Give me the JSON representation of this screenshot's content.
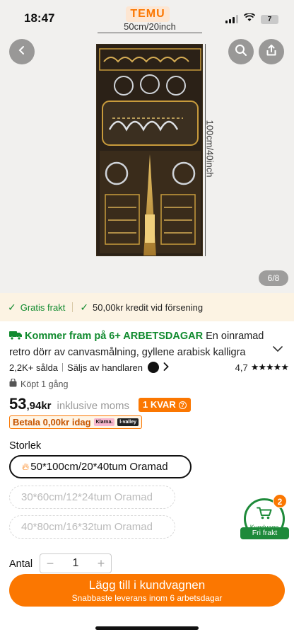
{
  "status_bar": {
    "time": "18:47",
    "battery": "7"
  },
  "brand": {
    "logo": "TEMU"
  },
  "product_image": {
    "width_label": "50cm/20inch",
    "height_label": "100cm/40inch",
    "counter": "6/8"
  },
  "benefits": {
    "free_shipping": "Gratis frakt",
    "late_credit": "50,00kr kredit vid försening"
  },
  "title": {
    "delivery": "Kommer fram på 6+ ARBETSDAGAR",
    "text": " En oinramad retro dörr av canvasmålning, gyllene arabisk kalligra"
  },
  "meta": {
    "sold": "2,2K+ sålda",
    "seller": "Säljs av handlaren",
    "rating": "4,7",
    "stars": "★★★★★",
    "bought": "Köpt 1 gång"
  },
  "price": {
    "main": "53",
    "decimal": ",94kr",
    "note": "inklusive moms",
    "stock": "1 KVAR",
    "pay_later": "Betala 0,00kr idag",
    "klarna": "Klarna.",
    "valley": "l-valley"
  },
  "size": {
    "label": "Storlek",
    "options": [
      {
        "label": "50*100cm/20*40tum Oramad",
        "selected": true
      },
      {
        "label": "30*60cm/12*24tum Oramad",
        "selected": false
      },
      {
        "label": "40*80cm/16*32tum Oramad",
        "selected": false
      }
    ]
  },
  "quantity": {
    "label": "Antal",
    "value": "1",
    "minus": "−",
    "plus": "+"
  },
  "cart": {
    "count": "2",
    "label": "Kundvagn",
    "free": "Fri frakt"
  },
  "cta": {
    "main": "Lägg till i kundvagnen",
    "sub": "Snabbaste leverans inom 6 arbetsdagar"
  },
  "colors": {
    "accent": "#fb7701",
    "green": "#108a2e",
    "benefit_bg": "#fcf3e3"
  },
  "icons": [
    "back-icon",
    "search-icon",
    "share-icon",
    "check-icon",
    "truck-icon",
    "bag-icon",
    "chevron-down-icon",
    "chevron-right-icon",
    "flame-icon",
    "cart-icon",
    "info-icon"
  ]
}
